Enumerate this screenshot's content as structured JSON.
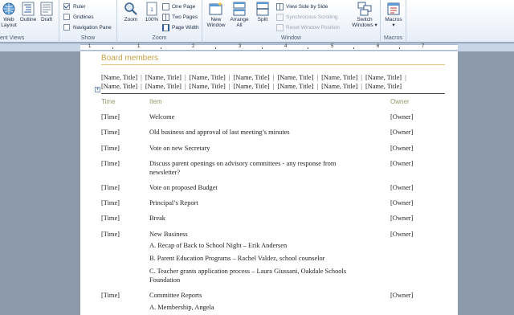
{
  "ribbon": {
    "groups": {
      "document_views": {
        "label": "ent Views",
        "buttons": [
          "Web\nLayout",
          "Outline",
          "Draft"
        ]
      },
      "show": {
        "label": "Show",
        "ruler": "Ruler",
        "gridlines": "Gridlines",
        "navigation_pane": "Navigation Pane"
      },
      "zoom": {
        "label": "Zoom",
        "zoom": "Zoom",
        "hundred": "100%",
        "one_page": "One Page",
        "two_pages": "Two Pages",
        "page_width": "Page Width"
      },
      "window": {
        "label": "Window",
        "new_window": "New\nWindow",
        "arrange_all": "Arrange\nAll",
        "split": "Split",
        "view_side_by_side": "View Side by Side",
        "synchronous_scrolling": "Synchronous Scrolling",
        "reset_window_position": "Reset Window Position",
        "switch_windows": "Switch\nWindows ▾"
      },
      "macros": {
        "label": "Macros",
        "macros": "Macros\n▾"
      }
    }
  },
  "ruler": {
    "numbers": [
      "1",
      "1",
      "2",
      "3",
      "4",
      "5",
      "6",
      "7"
    ]
  },
  "document": {
    "section_title": "Board members",
    "names_line1": [
      "[Name, Title]",
      "[Name, Title]",
      "[Name, Title]",
      "[Name, Title]",
      "[Name, Title]",
      "[Name, Title]",
      "[Name, Title]"
    ],
    "names_line2": [
      "[Name, Title]",
      "[Name, Title]",
      "[Name, Title]",
      "[Name, Title]",
      "[Name, Title]",
      "[Name, Title]",
      "[Name, Title]"
    ],
    "headers": {
      "time": "Time",
      "item": "Item",
      "owner": "Owner"
    },
    "rows": [
      {
        "time": "[Time]",
        "item": "Welcome",
        "owner": "[Owner]"
      },
      {
        "time": "[Time]",
        "item": "Old business and approval of last meeting’s minutes",
        "owner": "[Owner]"
      },
      {
        "time": "[Time]",
        "item": "Vote on new Secretary",
        "owner": "[Owner]"
      },
      {
        "time": "[Time]",
        "item": "Discuss parent openings on advisory committees - any response from newsletter?",
        "owner": "[Owner]"
      },
      {
        "time": "[Time]",
        "item": "Vote on proposed Budget",
        "owner": "[Owner]"
      },
      {
        "time": "[Time]",
        "item": "Principal’s Report",
        "owner": "[Owner]"
      },
      {
        "time": "[Time]",
        "item": "Break",
        "owner": "[Owner]"
      },
      {
        "time": "[Time]",
        "item": "New Business",
        "owner": "[Owner]"
      },
      {
        "time": "[Time]",
        "item": "Committee Reports",
        "owner": "[Owner]"
      }
    ],
    "new_business_subitems": [
      "A. Recap of Back to School Night – Erik Andersen",
      "B. Parent Education Programs – Rachel Valdez, school counselor",
      "C. Teacher grants application process – Laura Giussani, Oakdale Schools Foundation"
    ],
    "committee_subitems": [
      "A. Membership, Angela"
    ]
  }
}
